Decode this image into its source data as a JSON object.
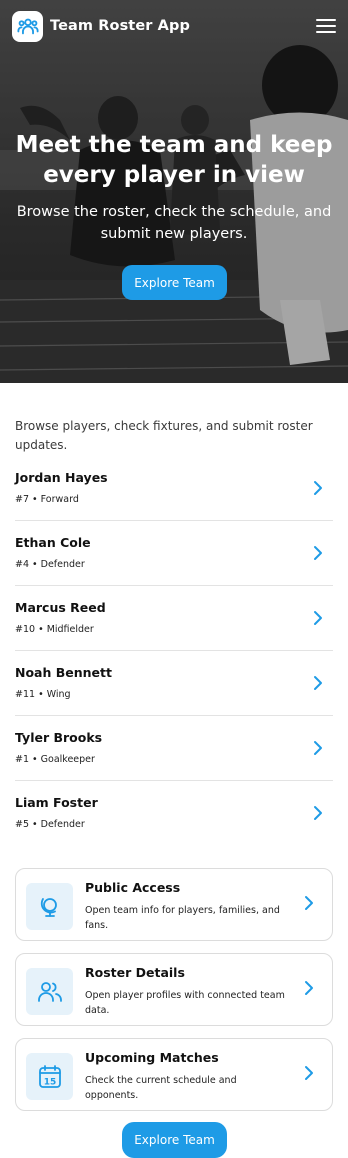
{
  "header": {
    "app_title": "Team Roster App",
    "logo_icon": "team-people-icon",
    "menu_icon": "hamburger-menu-icon"
  },
  "hero": {
    "title": "Meet the team and keep every player in view",
    "subtitle": "Browse the roster, check the schedule, and submit new players.",
    "cta_label": "Explore Team"
  },
  "main": {
    "intro": "Browse players, check fixtures, and submit roster updates.",
    "players": [
      {
        "name": "Jordan Hayes",
        "meta": "#7 • Forward"
      },
      {
        "name": "Ethan Cole",
        "meta": "#4 • Defender"
      },
      {
        "name": "Marcus Reed",
        "meta": "#10 • Midfielder"
      },
      {
        "name": "Noah Bennett",
        "meta": "#11 • Wing"
      },
      {
        "name": "Tyler Brooks",
        "meta": "#1 • Goalkeeper"
      },
      {
        "name": "Liam Foster",
        "meta": "#5 • Defender"
      }
    ],
    "cards": [
      {
        "title": "Public Access",
        "desc": "Open team info for players, families, and fans.",
        "icon": "globe-icon"
      },
      {
        "title": "Roster Details",
        "desc": "Open player profiles with connected team data.",
        "icon": "people-icon"
      },
      {
        "title": "Upcoming Matches",
        "desc": "Check the current schedule and opponents.",
        "icon": "calendar-icon",
        "icon_text": "15"
      }
    ],
    "bottom_cta_label": "Explore Team"
  },
  "colors": {
    "accent": "#1e9be6",
    "icon_bg": "#e6f2fa"
  }
}
